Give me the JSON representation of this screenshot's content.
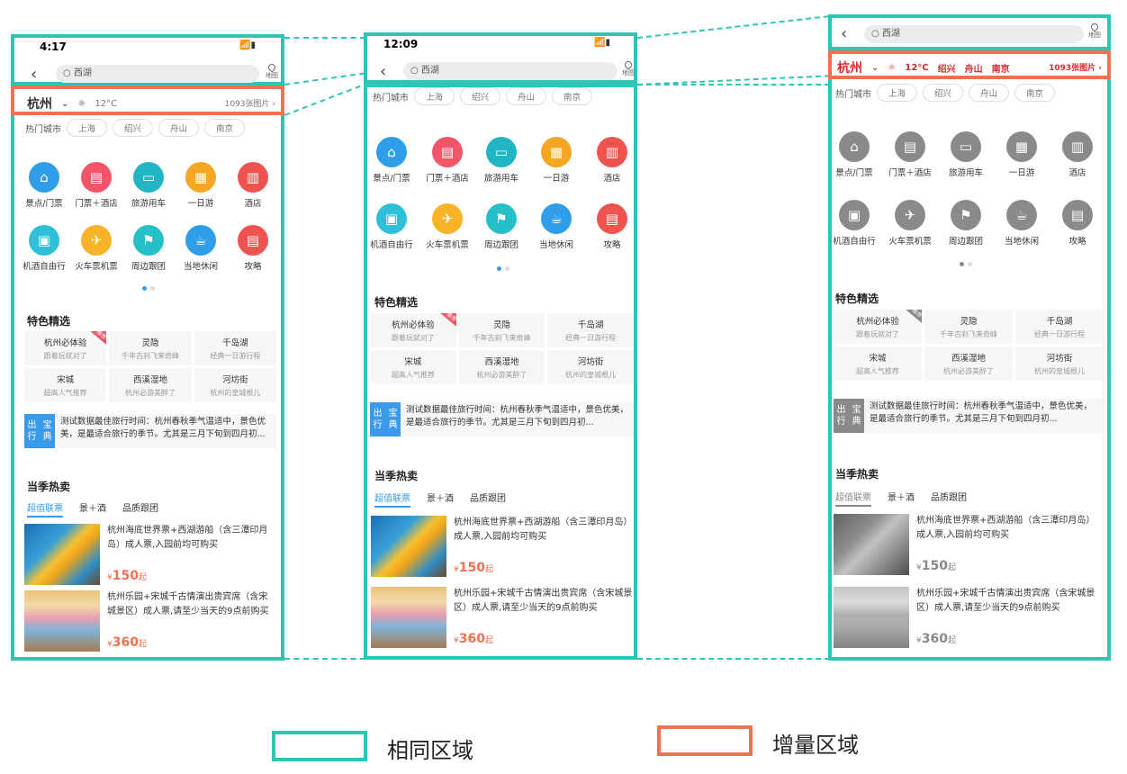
{
  "screens": {
    "left": {
      "time": "4:17",
      "search": "西湖",
      "map": "地图",
      "city": "杭州",
      "weather": "12°C",
      "photos": "1093张图片"
    },
    "mid": {
      "time": "12:09",
      "search": "西湖",
      "map": "地图"
    },
    "right": {
      "search": "西湖",
      "map": "地图",
      "city": "杭州",
      "weather": "12°C",
      "photos": "1093张图片"
    }
  },
  "hot_label": "热门城市",
  "hot_cities": [
    "上海",
    "绍兴",
    "舟山",
    "南京"
  ],
  "icons_row1": [
    "景点/门票",
    "门票＋酒店",
    "旅游用车",
    "一日游",
    "酒店"
  ],
  "icons_row2": [
    "机酒自由行",
    "火车票机票",
    "周边跟团",
    "当地休闲",
    "攻略"
  ],
  "featured_title": "特色精选",
  "featured": [
    {
      "t": "杭州必体验",
      "s": "跟着玩就对了",
      "badge": "推荐"
    },
    {
      "t": "灵隐",
      "s": "千年古刹飞来奇峰"
    },
    {
      "t": "千岛湖",
      "s": "经典一日游行程"
    },
    {
      "t": "宋城",
      "s": "超高人气推荐"
    },
    {
      "t": "西溪湿地",
      "s": "杭州必游美醉了"
    },
    {
      "t": "河坊街",
      "s": "杭州的皇城根儿"
    }
  ],
  "news": {
    "label1": "出行",
    "label2": "宝典",
    "text": "测试数据最佳旅行时间：杭州春秋季气温适中，景色优美，是最适合旅行的季节。尤其是三月下旬到四月初..."
  },
  "season_title": "当季热卖",
  "tabs": [
    "超值联票",
    "景＋酒",
    "品质跟团"
  ],
  "products": [
    {
      "title": "杭州海底世界票+西湖游船（含三潭印月岛）成人票,入园前均可购买",
      "price": "150",
      "cur": "¥",
      "suffix": "起"
    },
    {
      "title": "杭州乐园+宋城千古情演出贵宾席（含宋城景区）成人票,请至少当天的9点前购买",
      "price": "360",
      "cur": "¥",
      "suffix": "起"
    }
  ],
  "legend": {
    "same": "相同区域",
    "inc": "增量区域"
  },
  "colors": {
    "teal": "#2ec5b6",
    "orange": "#f0714f",
    "accent": "#3a9ae8"
  }
}
